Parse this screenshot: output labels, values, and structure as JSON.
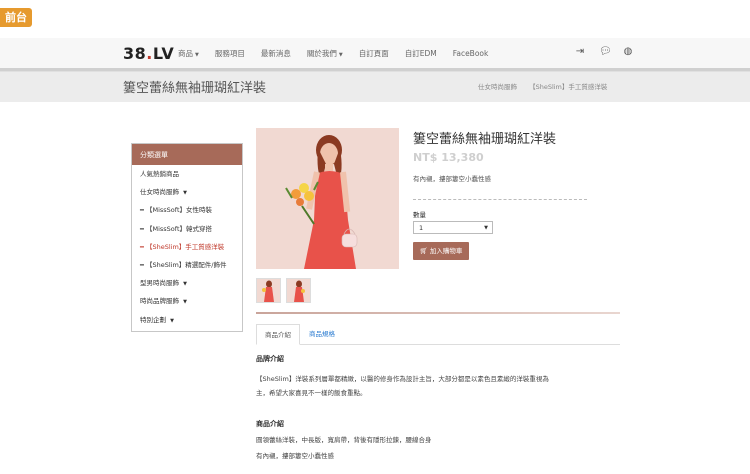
{
  "badge": "前台",
  "header": {
    "logo": "38.LV",
    "logo_main": "38",
    "logo_dot": ".",
    "logo_tail": "LV",
    "nav": [
      {
        "label": "商品",
        "dropdown": true
      },
      {
        "label": "服務項目",
        "dropdown": false
      },
      {
        "label": "最新消息",
        "dropdown": false
      },
      {
        "label": "關於我們",
        "dropdown": true
      },
      {
        "label": "自訂頁面",
        "dropdown": false
      },
      {
        "label": "自訂EDM",
        "dropdown": false
      },
      {
        "label": "FaceBook",
        "dropdown": false
      }
    ],
    "icons": [
      "login-icon",
      "chat-icon",
      "globe-icon"
    ]
  },
  "titlebar": {
    "title": "簍空蕾絲無袖珊瑚紅洋裝",
    "breadcrumb": [
      "仕女時尚服飾",
      "【SheSlim】手工質感洋裝"
    ]
  },
  "sidebar": {
    "heading": "分類選單",
    "items": [
      {
        "label": "人氣熱銷商品",
        "caret": false,
        "prefix": "",
        "active": false
      },
      {
        "label": "仕女時尚服飾",
        "caret": true,
        "prefix": "",
        "active": false
      },
      {
        "label": "【MissSoft】女性時裝",
        "caret": false,
        "prefix": "━ ",
        "active": false
      },
      {
        "label": "【MissSoft】韓式穿搭",
        "caret": false,
        "prefix": "━ ",
        "active": false
      },
      {
        "label": "【SheSlim】手工質感洋裝",
        "caret": false,
        "prefix": "━ ",
        "active": true
      },
      {
        "label": "【SheSlim】精選配件/飾件",
        "caret": false,
        "prefix": "━ ",
        "active": false
      },
      {
        "label": "型男時尚服飾",
        "caret": true,
        "prefix": "",
        "active": false
      },
      {
        "label": "時尚品牌服飾",
        "caret": true,
        "prefix": "",
        "active": false
      },
      {
        "label": "特別企劃",
        "caret": true,
        "prefix": "",
        "active": false
      }
    ]
  },
  "product": {
    "name": "簍空蕾絲無袖珊瑚紅洋裝",
    "price": "NT$ 13,380",
    "note": "有內襯，摟部簍空小蠢性感",
    "qty_label": "數量",
    "qty_value": "1",
    "cart_label": "加入購物車"
  },
  "tabs": [
    "商品介紹",
    "商品規格"
  ],
  "description": {
    "brand_title": "品牌介紹",
    "brand_text_1": "【SheSlim】洋裝系列層單都精緻，以醫的修身作為設計主旨，大部分都是以素色且素緞的洋裝重視為",
    "brand_text_2": "主，希望大家喜見不一樣的飯食重點。",
    "product_title": "商品介紹",
    "product_text_1": "圓領蕾絲洋裝，中長版，寬肩帶，背後有隱形拉鍊，腰線合身",
    "product_text_2": "有內襯，摟部簍空小蠢性感"
  },
  "colors": {
    "accent": "#a76a59",
    "badge": "#e69a2e",
    "dress": "#e8524a"
  }
}
